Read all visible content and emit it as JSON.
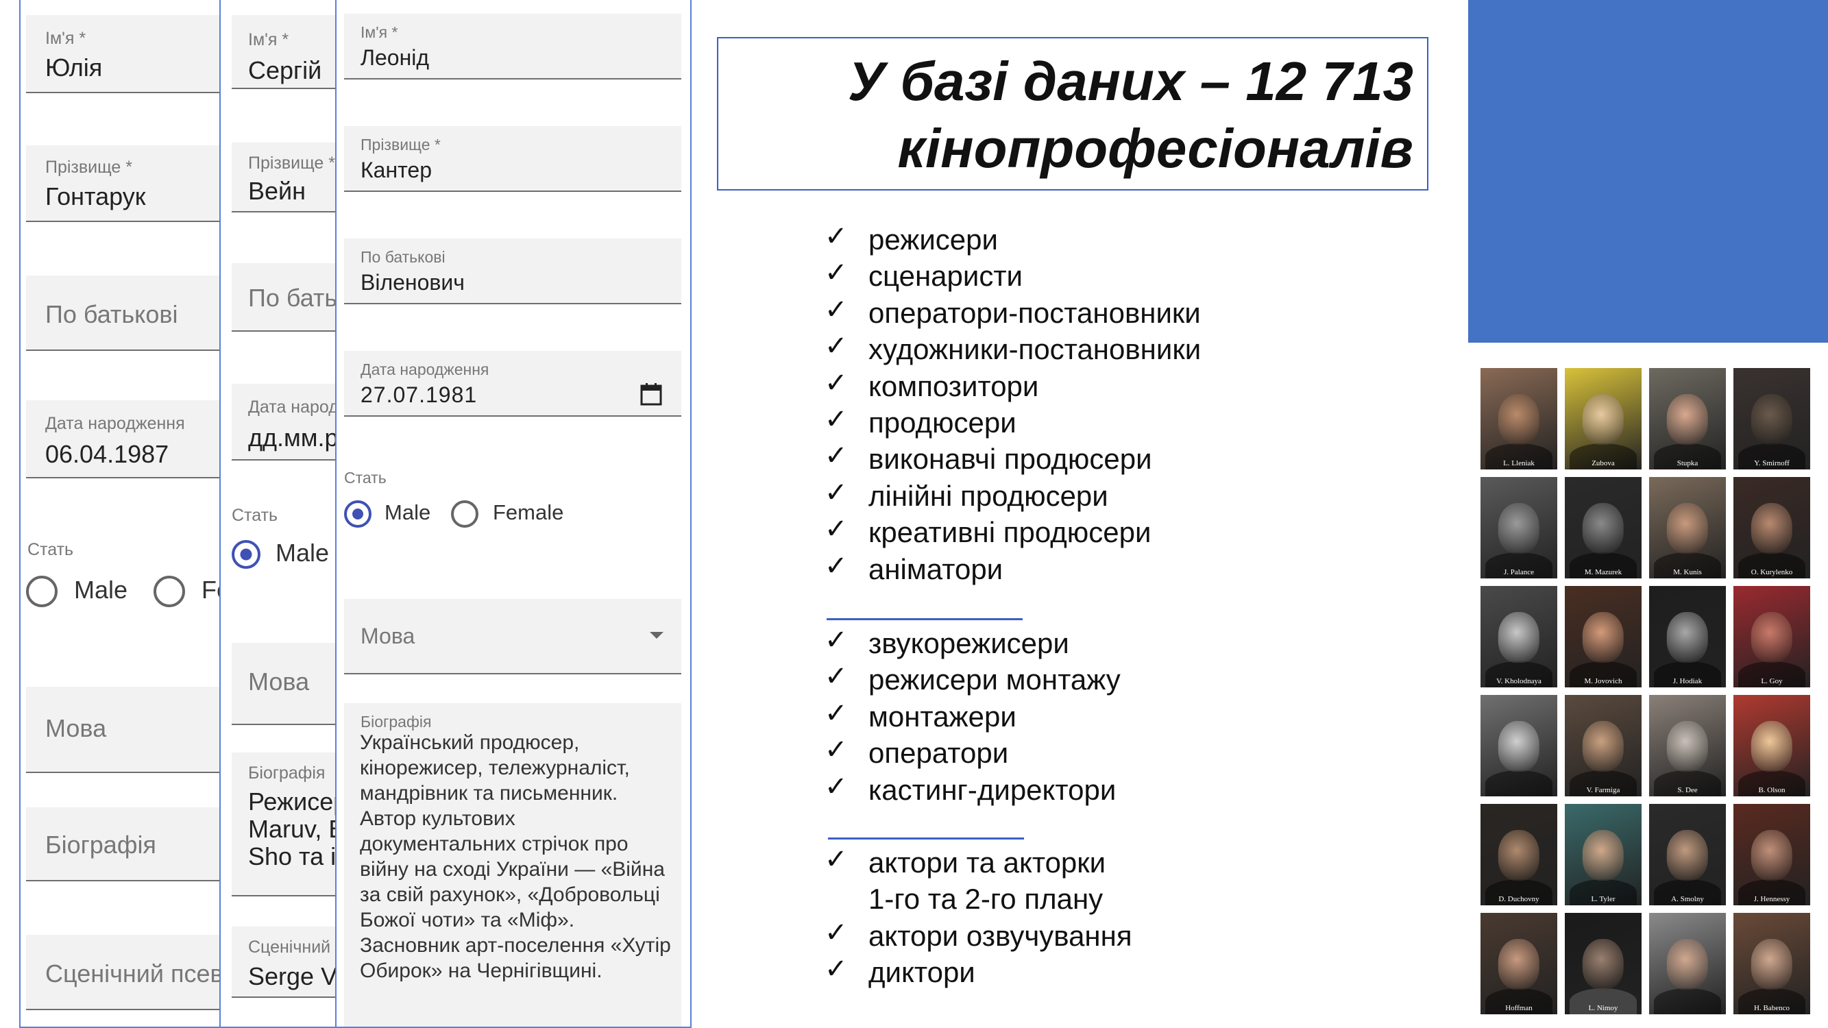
{
  "form1": {
    "first_name_label": "Ім'я *",
    "first_name_value": "Юлія",
    "last_name_label": "Прізвище *",
    "last_name_value": "Гонтарук",
    "patronymic_placeholder": "По батькові",
    "birth_date_label": "Дата народження",
    "birth_date_value": "06.04.1987",
    "gender_label": "Стать",
    "gender_male": "Male",
    "gender_female_partial": "Fe",
    "language_placeholder": "Мова",
    "bio_placeholder": "Біографія",
    "stage_name_placeholder": "Сценічний псев"
  },
  "form2": {
    "first_name_label": "Ім'я *",
    "first_name_value": "Сергій",
    "last_name_label": "Прізвище *",
    "last_name_value": "Вейн",
    "patronymic_placeholder": "По бать",
    "birth_date_label": "Дата народ",
    "birth_date_placeholder": "дд.мм.р",
    "gender_label": "Стать",
    "gender_male": "Male",
    "gender_selected": "Male",
    "language_placeholder": "Мова",
    "bio_label": "Біографія",
    "bio_lines": [
      "Режисер",
      "Maruv, B",
      "Sho та ін"
    ],
    "stage_name_label": "Сценічний",
    "stage_name_value": "Serge Va"
  },
  "form3": {
    "first_name_label": "Ім'я *",
    "first_name_value": "Леонід",
    "last_name_label": "Прізвище *",
    "last_name_value": "Кантер",
    "patronymic_label": "По батькові",
    "patronymic_value": "Віленович",
    "birth_date_label": "Дата народження",
    "birth_date_value": "27.07.1981",
    "gender_label": "Стать",
    "gender_male": "Male",
    "gender_female": "Female",
    "gender_selected": "Male",
    "language_placeholder": "Мова",
    "bio_label": "Біографія",
    "bio_text": "Український продюсер, кінорежисер, тележурналіст, мандрівник та письменник. Автор культових документальних стрічок про війну на сході України — «Війна за свій рахунок», «Добровольці Божої чоти» та «Міф». Засновник арт-поселення «Хутір Обирок» на Чернігівщині."
  },
  "slide": {
    "title_line1": "У базі даних – 12 713",
    "title_line2": "кінопрофесіоналів",
    "check_glyph": "✓",
    "group1": [
      "режисери",
      "сценаристи",
      "оператори-постановники",
      "художники-постановники",
      "композитори",
      "продюсери",
      "виконавчі продюсери",
      "лінійні продюсери",
      "креативні продюсери",
      "аніматори"
    ],
    "group2": [
      "звукорежисери",
      "режисери монтажу",
      "монтажери",
      "оператори",
      "кастинг-директори"
    ],
    "group3_item1_line1": "актори та акторки",
    "group3_item1_line2": "1-го та 2-го плану",
    "group3_item2": "актори озвучування",
    "group3_item3": "диктори",
    "accent_color": "#3b5fc4",
    "block_color": "#4472c4"
  },
  "photos": [
    {
      "caption": "L. Lleniak",
      "tone": "#b98a6a",
      "bg": "#8a6a55"
    },
    {
      "caption": "Zubova",
      "tone": "#e8c9a0",
      "bg": "#d9c23a"
    },
    {
      "caption": "Stupka",
      "tone": "#d9a88f",
      "bg": "#6d6a60"
    },
    {
      "caption": "Y. Smirnoff",
      "tone": "#6a5a4c",
      "bg": "#3a3230"
    },
    {
      "caption": "J. Palance",
      "tone": "#9a9a9a",
      "bg": "#5a5a5a"
    },
    {
      "caption": "M. Mazurek",
      "tone": "#8a8a8a",
      "bg": "#2a2a2a"
    },
    {
      "caption": "M. Kunis",
      "tone": "#c89a7e",
      "bg": "#7a6a5a"
    },
    {
      "caption": "O. Kurylenko",
      "tone": "#b88a70",
      "bg": "#3a2a25"
    },
    {
      "caption": "V. Kholodnaya",
      "tone": "#c8c8c8",
      "bg": "#4a4a4a"
    },
    {
      "caption": "M. Jovovich",
      "tone": "#d49a7a",
      "bg": "#4a2e22"
    },
    {
      "caption": "J. Hodiak",
      "tone": "#a8a8a8",
      "bg": "#1e1e1e"
    },
    {
      "caption": "L. Goy",
      "tone": "#c87a6a",
      "bg": "#9a2a30"
    },
    {
      "caption": "",
      "tone": "#d0d0d0",
      "bg": "#707070"
    },
    {
      "caption": "V. Farmiga",
      "tone": "#c9a080",
      "bg": "#5a4a3e"
    },
    {
      "caption": "S. Dee",
      "tone": "#c8c0b8",
      "bg": "#8a8078"
    },
    {
      "caption": "B. Olson",
      "tone": "#ecc89a",
      "bg": "#b03a30"
    },
    {
      "caption": "D. Duchovny",
      "tone": "#b08a6e",
      "bg": "#2a2622"
    },
    {
      "caption": "L. Tyler",
      "tone": "#d0a88a",
      "bg": "#3a6a6a"
    },
    {
      "caption": "A. Smolny",
      "tone": "#c09a80",
      "bg": "#2a2a2a"
    },
    {
      "caption": "J. Hennessy",
      "tone": "#c0907a",
      "bg": "#5a2a20"
    },
    {
      "caption": "Hoffman",
      "tone": "#c89a80",
      "bg": "#4a3a30"
    },
    {
      "caption": "L. Nimoy",
      "tone": "#9a8070",
      "bg": "#1a1a1a"
    },
    {
      "caption": "",
      "tone": "#d0a890",
      "bg": "#8a8a8a"
    },
    {
      "caption": "H. Babenco",
      "tone": "#d0a890",
      "bg": "#6a4a38"
    }
  ]
}
